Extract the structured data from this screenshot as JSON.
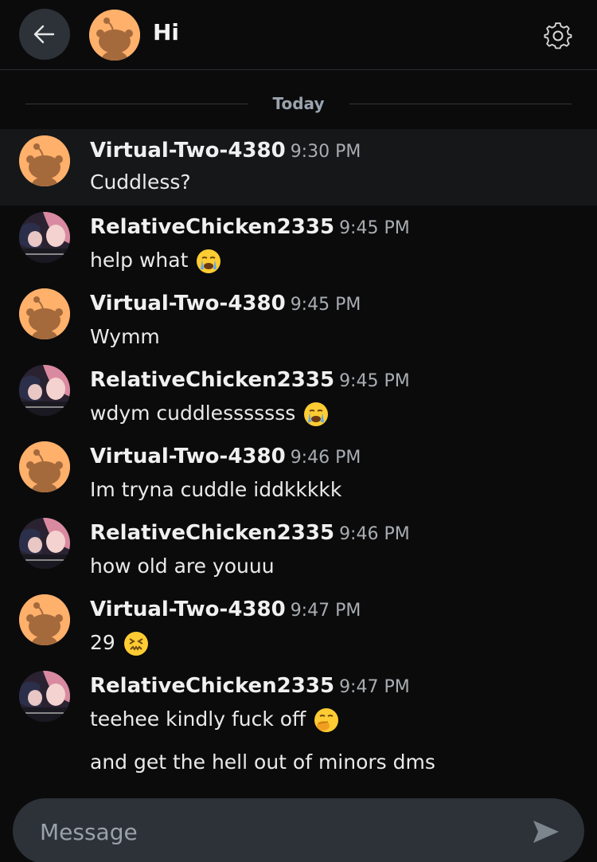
{
  "header": {
    "title": "Hi",
    "back_icon": "arrow-left-icon",
    "settings_icon": "gear-icon"
  },
  "divider": {
    "label": "Today"
  },
  "messages": [
    {
      "username": "Virtual-Two-4380",
      "time": "9:30 PM",
      "text": "Cuddless?",
      "avatar": "snoo",
      "emoji": ""
    },
    {
      "username": "RelativeChicken2335",
      "time": "9:45 PM",
      "text": "help what",
      "avatar": "anime",
      "emoji": "crying-face"
    },
    {
      "username": "Virtual-Two-4380",
      "time": "9:45 PM",
      "text": "Wymm",
      "avatar": "snoo",
      "emoji": ""
    },
    {
      "username": "RelativeChicken2335",
      "time": "9:45 PM",
      "text": "wdym cuddlesssssss",
      "avatar": "anime",
      "emoji": "crying-face"
    },
    {
      "username": "Virtual-Two-4380",
      "time": "9:46 PM",
      "text": "Im tryna cuddle iddkkkkk",
      "avatar": "snoo",
      "emoji": ""
    },
    {
      "username": "RelativeChicken2335",
      "time": "9:46 PM",
      "text": "how old are youuu",
      "avatar": "anime",
      "emoji": ""
    },
    {
      "username": "Virtual-Two-4380",
      "time": "9:47 PM",
      "text": "29",
      "avatar": "snoo",
      "emoji": "confounded-face"
    },
    {
      "username": "RelativeChicken2335",
      "time": "9:47 PM",
      "text": "teehee kindly fuck off",
      "avatar": "anime",
      "emoji": "hand-over-mouth-face"
    }
  ],
  "extra_message": {
    "text": "and get the hell out of minors dms"
  },
  "composer": {
    "placeholder": "Message",
    "send_icon": "send-icon"
  },
  "colors": {
    "background": "#0b0b0c",
    "snoo_avatar": "#ffb06b",
    "header_button": "#2c3238",
    "divider_text": "#9aa4ae"
  }
}
